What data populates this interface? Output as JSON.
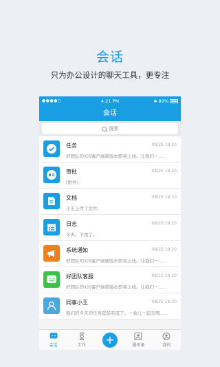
{
  "promo": {
    "title": "会话",
    "subtitle": "只为办公设计的聊天工具，更专注"
  },
  "statusbar": {
    "signal": "●●●●○",
    "carrier": "",
    "time": "4:21 PM",
    "bluetooth": "✱",
    "battery": "89%"
  },
  "navbar": {
    "title": "会话"
  },
  "search": {
    "placeholder": "搜索"
  },
  "conversations": [
    {
      "title": "任务",
      "time": "08/25 19:20",
      "preview": "好团队的iOS客户端新版本即将上线。让我们一......",
      "icon": "check-circle-icon",
      "color": "#1a9ee3"
    },
    {
      "title": "审批",
      "time": "08/25 19:20",
      "preview": "[附件]",
      "icon": "approval-icon",
      "color": "#1a9ee3"
    },
    {
      "title": "文档",
      "time": "08/25 19:20",
      "preview": "小王上传了文件。",
      "icon": "document-icon",
      "color": "#1a9ee3"
    },
    {
      "title": "日志",
      "time": "08/25 19:20",
      "preview": "今天，下雨了。",
      "icon": "calendar-icon",
      "color": "#1a9ee3"
    },
    {
      "title": "系统通知",
      "time": "08/25 19:20",
      "preview": "好团队的iOS客户端新版本即将上线。让我们一......",
      "icon": "megaphone-icon",
      "color": "#f07f1a"
    },
    {
      "title": "好团队客服",
      "time": "08/25 19:20",
      "preview": "好团队的iOS客户端新版本即将上线。让我们一......",
      "icon": "smile-icon",
      "color": "#3cc14a"
    },
    {
      "title": "同事小王",
      "time": "08/25 19:20",
      "preview": "我们的今天的任务提前完成了。一会儿一起去喝......",
      "icon": "person-icon",
      "color": "#4aa7e0"
    }
  ],
  "tabs": [
    {
      "label": "会话",
      "icon": "chat-icon",
      "active": true
    },
    {
      "label": "工作",
      "icon": "hourglass-icon",
      "active": false
    },
    {
      "label": "",
      "icon": "plus-icon",
      "active": false
    },
    {
      "label": "通讯录",
      "icon": "contacts-icon",
      "active": false
    },
    {
      "label": "我的",
      "icon": "profile-icon",
      "active": false
    }
  ]
}
